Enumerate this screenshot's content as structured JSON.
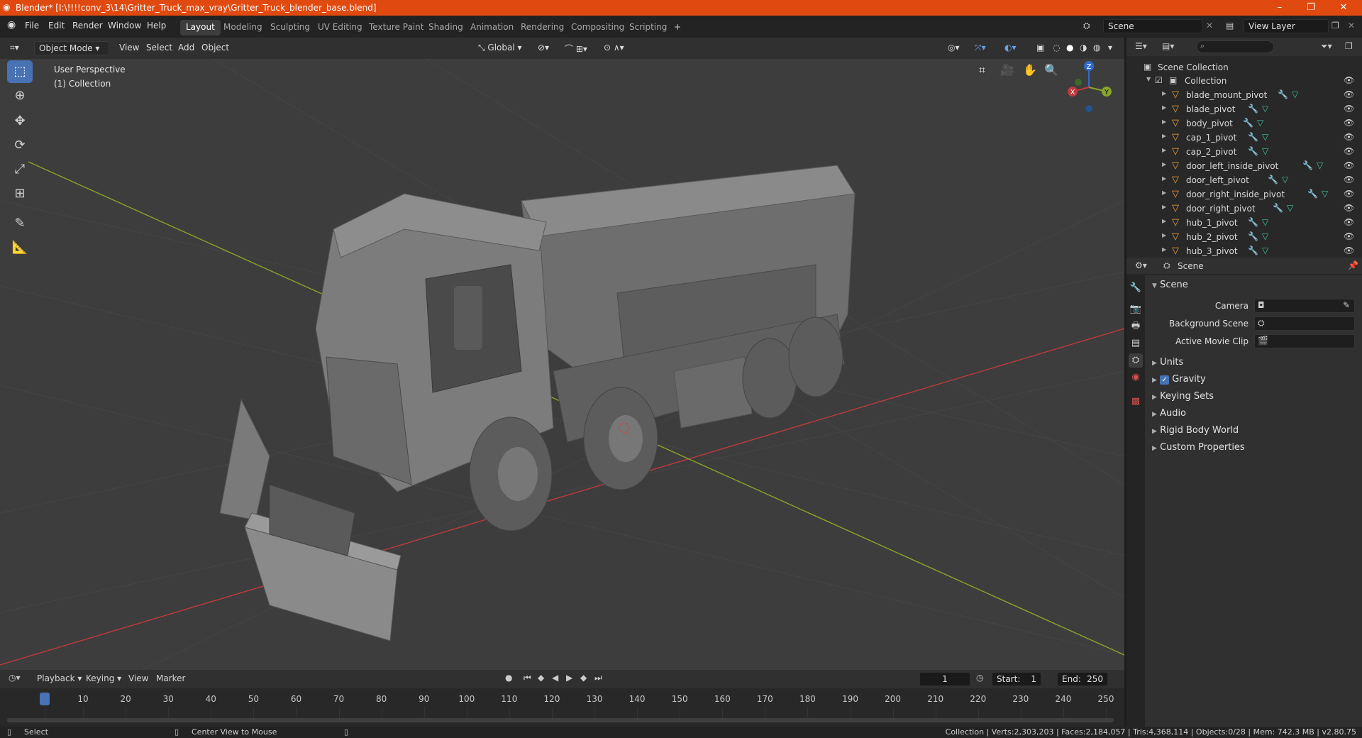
{
  "titlebar": {
    "title": "Blender* [I:\\!!!!conv_3\\14\\Gritter_Truck_max_vray\\Gritter_Truck_blender_base.blend]",
    "minimize": "–",
    "maximize": "❐",
    "close": "✕",
    "color": "#e04a10"
  },
  "menu": {
    "items": [
      "File",
      "Edit",
      "Render",
      "Window",
      "Help"
    ]
  },
  "workspaces": [
    "Layout",
    "Modeling",
    "Sculpting",
    "UV Editing",
    "Texture Paint",
    "Shading",
    "Animation",
    "Rendering",
    "Compositing",
    "Scripting"
  ],
  "workspace_active": "Layout",
  "add_workspace": "+",
  "scene_selector": "Scene",
  "view_layer_selector": "View Layer",
  "viewport_header": {
    "mode": "Object Mode",
    "menus": [
      "View",
      "Select",
      "Add",
      "Object"
    ],
    "orientation": "Global"
  },
  "viewport": {
    "perspective_label": "User Perspective",
    "collection_label": "(1) Collection",
    "axes": {
      "z": "Z",
      "y": "Y",
      "x": "X"
    },
    "colors": {
      "bg": "#3d3d3d",
      "x_axis": "#c0393b",
      "y_axis": "#8aa52a",
      "z_axis": "#2f6cc9"
    }
  },
  "outliner": {
    "search_placeholder": "",
    "root": "Scene Collection",
    "collection": "Collection",
    "items": [
      "blade_mount_pivot",
      "blade_pivot",
      "body_pivot",
      "cap_1_pivot",
      "cap_2_pivot",
      "door_left_inside_pivot",
      "door_left_pivot",
      "door_right_inside_pivot",
      "door_right_pivot",
      "hub_1_pivot",
      "hub_2_pivot",
      "hub_3_pivot"
    ]
  },
  "properties": {
    "context_label": "Scene",
    "panel_title": "Scene",
    "fields": [
      {
        "label": "Camera"
      },
      {
        "label": "Background Scene"
      },
      {
        "label": "Active Movie Clip"
      }
    ],
    "sections": [
      "Units",
      "Gravity",
      "Keying Sets",
      "Audio",
      "Rigid Body World",
      "Custom Properties"
    ],
    "gravity_checked": true
  },
  "timeline": {
    "menus": [
      "Playback",
      "Keying",
      "View",
      "Marker"
    ],
    "current_frame": "1",
    "start_label": "Start:",
    "start_value": "1",
    "end_label": "End:",
    "end_value": "250",
    "ticks": [
      "1",
      "10",
      "20",
      "30",
      "40",
      "50",
      "60",
      "70",
      "80",
      "90",
      "100",
      "110",
      "120",
      "130",
      "140",
      "150",
      "160",
      "170",
      "180",
      "190",
      "200",
      "210",
      "220",
      "230",
      "240",
      "250"
    ]
  },
  "statusbar": {
    "left": "Select",
    "middle": "Center View to Mouse",
    "stats": "Collection | Verts:2,303,203 | Faces:2,184,057 | Tris:4,368,114 | Objects:0/28 | Mem: 742.3 MB | v2.80.75"
  }
}
